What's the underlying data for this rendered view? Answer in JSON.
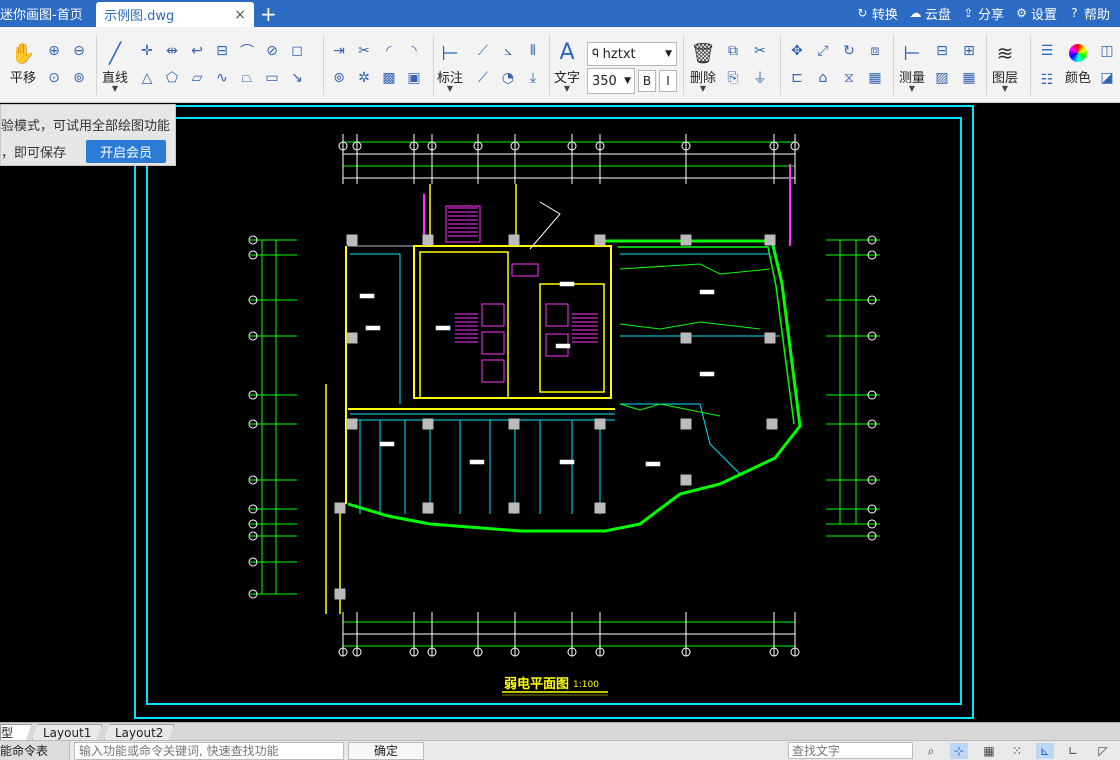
{
  "titlebar": {
    "home_tab": "迷你画图-首页",
    "active_tab": "示例图.dwg",
    "close_glyph": "×",
    "add_glyph": "+",
    "actions": [
      {
        "label": "转换",
        "icon": "convert-icon",
        "glyph": "↻"
      },
      {
        "label": "云盘",
        "icon": "cloud-icon",
        "glyph": "☁"
      },
      {
        "label": "分享",
        "icon": "share-icon",
        "glyph": "⇪"
      },
      {
        "label": "设置",
        "icon": "gear-icon",
        "glyph": "⚙"
      },
      {
        "label": "帮助",
        "icon": "help-icon",
        "glyph": "?"
      }
    ]
  },
  "ribbon": {
    "pan": "平移",
    "line": "直线",
    "dimension": "标注",
    "text": "文字",
    "font": "hztxt",
    "font_size": "350",
    "bold": "B",
    "italic": "I",
    "delete": "删除",
    "measure": "测量",
    "layer": "图层",
    "color": "颜色"
  },
  "notice": {
    "line1": "验模式，可试用全部绘图功能",
    "line2": "，即可保存",
    "button": "开启会员"
  },
  "drawing": {
    "title": "弱电平面图",
    "scale": "1:100",
    "colors": {
      "border": "#00e5ff",
      "walls": "#ffff00",
      "green": "#00ff00",
      "magenta": "#ff33ff",
      "white": "#ffffff",
      "grey": "#bbbbbb"
    }
  },
  "layout_tabs": [
    "型",
    "Layout1",
    "Layout2"
  ],
  "command": {
    "label": "能命令表",
    "placeholder": "输入功能或命令关键词, 快速查找功能",
    "confirm": "确定",
    "find_placeholder": "查找文字"
  }
}
